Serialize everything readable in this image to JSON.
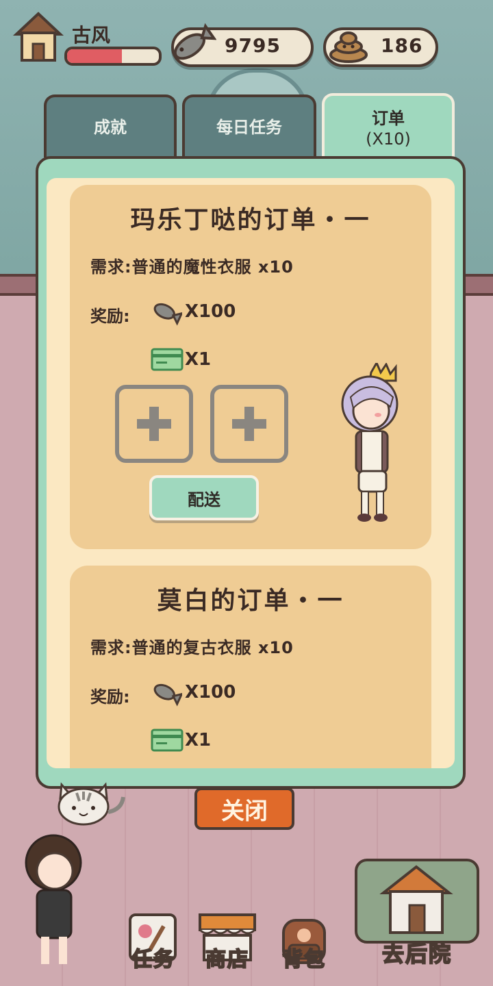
{
  "player": {
    "name": "古风",
    "hp_fraction": 0.6
  },
  "currencies": {
    "fish": "9795",
    "poop": "186"
  },
  "tabs": [
    {
      "label": "成就"
    },
    {
      "label": "每日任务"
    },
    {
      "label": "订单",
      "sublabel": "(X10)"
    }
  ],
  "orders": [
    {
      "title": "玛乐丁哒的订单・一",
      "requirement": "需求:普通的魔性衣服 x10",
      "reward_label": "奖励:",
      "fish_reward": "X100",
      "card_reward": "X1",
      "deliver_label": "配送"
    },
    {
      "title": "莫白的订单・一",
      "requirement": "需求:普通的复古衣服 x10",
      "reward_label": "奖励:",
      "fish_reward": "X100",
      "card_reward": "X1"
    }
  ],
  "close_label": "关闭",
  "nav": {
    "tasks": "任务",
    "shop": "商店",
    "bag": "背包",
    "backyard": "去后院"
  },
  "colors": {
    "panel": "#9fd8be",
    "card": "#efcc94",
    "close_button": "#e06a2a",
    "hp": "#e05d63"
  },
  "icons": [
    "house-icon",
    "fish-icon",
    "poop-icon",
    "card-icon",
    "plus-icon",
    "cat-icon",
    "character-icon"
  ]
}
